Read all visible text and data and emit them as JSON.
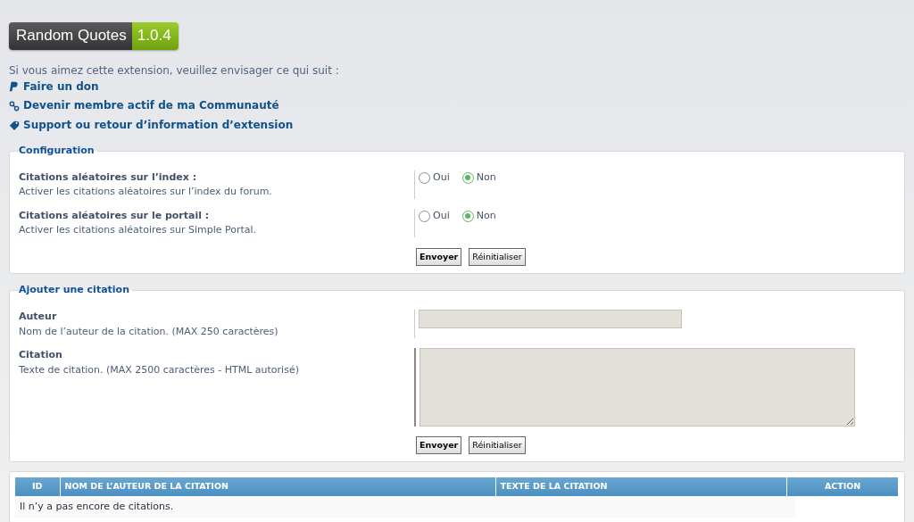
{
  "header": {
    "title": "Random Quotes",
    "version": "1.0.4"
  },
  "intro": "Si vous aimez cette extension, veuillez envisager ce qui suit :",
  "links": [
    {
      "kind": "paypal",
      "label": "Faire un don"
    },
    {
      "kind": "link",
      "label": "Devenir membre actif de ma Communauté"
    },
    {
      "kind": "tag",
      "label": "Support ou retour d’information d’extension"
    }
  ],
  "configuration": {
    "legend": "Configuration",
    "settings": [
      {
        "label": "Citations aléatoires sur l’index :",
        "description": "Activer les citations aléatoires sur l’index du forum.",
        "options": [
          {
            "label": "Oui",
            "selected": false
          },
          {
            "label": "Non",
            "selected": true
          }
        ]
      },
      {
        "label": "Citations aléatoires sur le portail :",
        "description": "Activer les citations aléatoires sur Simple Portal.",
        "options": [
          {
            "label": "Oui",
            "selected": false
          },
          {
            "label": "Non",
            "selected": true
          }
        ]
      }
    ],
    "buttons": [
      "Envoyer",
      "Réinitialiser"
    ]
  },
  "add_quote": {
    "legend": "Ajouter une citation",
    "fields": [
      {
        "kind": "input",
        "label": "Auteur",
        "description": "Nom de l’auteur de la citation. (MAX 250 caractères)"
      },
      {
        "kind": "textarea",
        "label": "Citation",
        "description": "Texte de citation. (MAX 2500 caractères - HTML autorisé)"
      }
    ],
    "buttons": [
      "Envoyer",
      "Réinitialiser"
    ]
  },
  "table": {
    "columns": [
      "ID",
      "NOM DE L’AUTEUR DE LA CITATION",
      "TEXTE DE LA CITATION",
      "ACTION"
    ],
    "empty_message": "Il n’y a pas encore de citations."
  }
}
